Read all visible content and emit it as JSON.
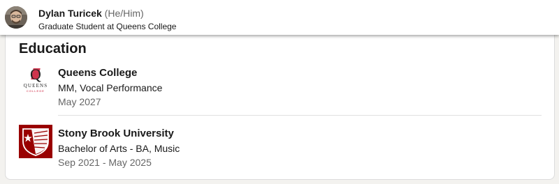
{
  "profile": {
    "name": "Dylan Turicek",
    "pronouns": "(He/Him)",
    "headline": "Graduate Student at Queens College"
  },
  "education": {
    "title": "Education",
    "entries": [
      {
        "school": "Queens College",
        "degree": "MM, Vocal Performance",
        "dates": "May 2027",
        "logo": {
          "icon": "queens-college-logo",
          "letter": "Q",
          "wordmark": "QUEENS",
          "subtext": "COLLEGE",
          "accent_color": "#c8102e"
        }
      },
      {
        "school": "Stony Brook University",
        "degree": "Bachelor of Arts - BA, Music",
        "dates": "Sep 2021 - May 2025",
        "logo": {
          "icon": "stony-brook-shield-logo",
          "background_color": "#990000"
        }
      }
    ]
  },
  "colors": {
    "page_background": "#f3f2ef",
    "card_background": "#ffffff",
    "primary_text": "#191919",
    "secondary_text": "#666666"
  }
}
